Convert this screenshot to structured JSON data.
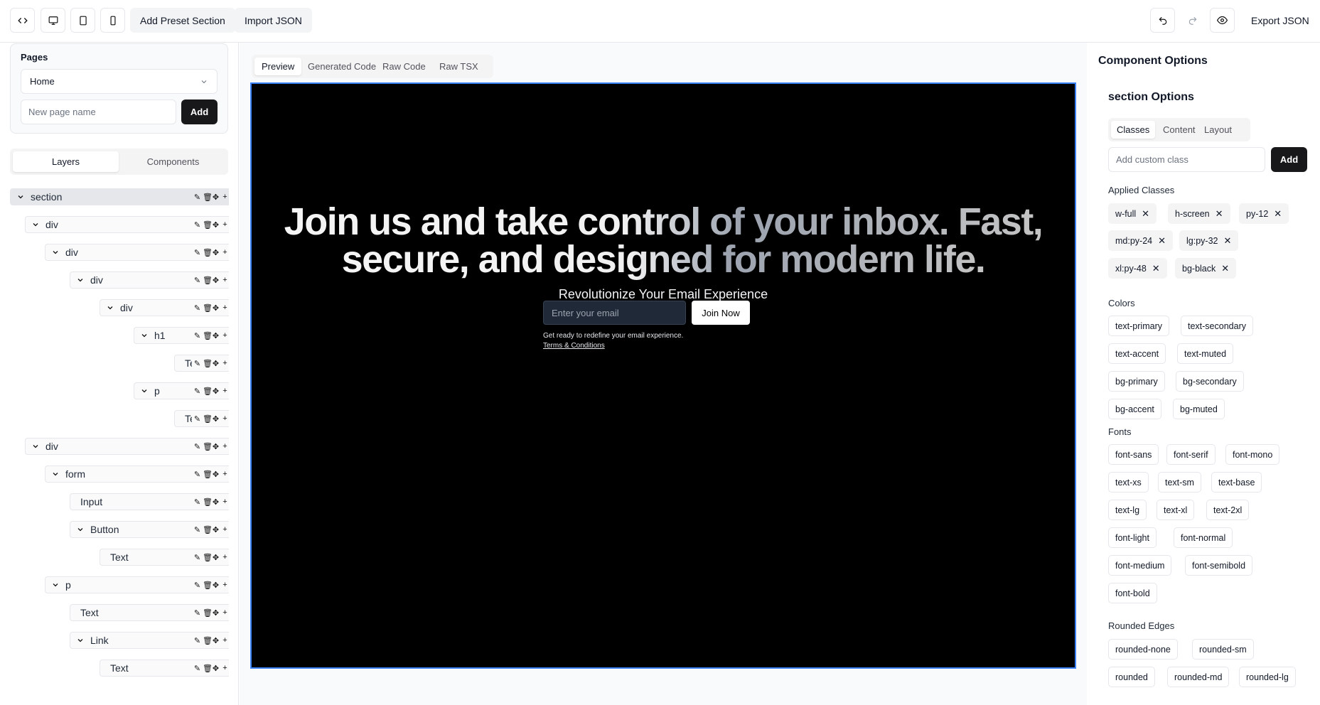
{
  "toolbar": {
    "code_icon": "code-icon",
    "desktop_icon": "monitor-icon",
    "tablet_icon": "tablet-icon",
    "mobile_icon": "smartphone-icon",
    "add_preset": "Add Preset Section",
    "import_json": "Import JSON",
    "undo_icon": "undo-icon",
    "redo_icon": "redo-icon",
    "preview_icon": "eye-icon",
    "export_json": "Export JSON"
  },
  "pages": {
    "title": "Pages",
    "selected": "Home",
    "new_page_placeholder": "New page name",
    "add_label": "Add"
  },
  "left_tabs": [
    "Layers",
    "Components"
  ],
  "layers": [
    {
      "label": "section",
      "indent": 0,
      "expanded": true,
      "selected": true
    },
    {
      "label": "div",
      "indent": 1,
      "expanded": true
    },
    {
      "label": "div",
      "indent": 2,
      "expanded": true
    },
    {
      "label": "div",
      "indent": 3,
      "expanded": true
    },
    {
      "label": "div",
      "indent": 4,
      "expanded": true
    },
    {
      "label": "h1",
      "indent": 5,
      "expanded": true
    },
    {
      "label": "Text",
      "indent": 6,
      "expanded": false
    },
    {
      "label": "p",
      "indent": 5,
      "expanded": true
    },
    {
      "label": "Text",
      "indent": 6,
      "expanded": false
    },
    {
      "label": "div",
      "indent": 1,
      "expanded": true
    },
    {
      "label": "form",
      "indent": 2,
      "expanded": true
    },
    {
      "label": "Input",
      "indent": 3,
      "expanded": false
    },
    {
      "label": "Button",
      "indent": 3,
      "expanded": true
    },
    {
      "label": "Text",
      "indent": 4,
      "expanded": false
    },
    {
      "label": "p",
      "indent": 2,
      "expanded": true
    },
    {
      "label": "Text",
      "indent": 3,
      "expanded": false
    },
    {
      "label": "Link",
      "indent": 3,
      "expanded": true
    },
    {
      "label": "Text",
      "indent": 4,
      "expanded": false
    }
  ],
  "canvas_tabs": [
    "Preview",
    "Generated Code",
    "Raw Code",
    "Raw TSX"
  ],
  "preview": {
    "headline_a": "Join us and take control of your inbox. Fast,",
    "headline_b": "secure, and designed for modern life.",
    "subheading": "Revolutionize Your Email Experience",
    "email_placeholder": "Enter your email",
    "join_label": "Join Now",
    "note": "Get ready to redefine your email experience.",
    "terms": "Terms & Conditions"
  },
  "options": {
    "title": "Component Options",
    "section_title": "section Options",
    "tabs": [
      "Classes",
      "Content",
      "Layout"
    ],
    "custom_class_placeholder": "Add custom class",
    "add_label": "Add",
    "applied_title": "Applied Classes",
    "applied": [
      "w-full",
      "h-screen",
      "py-12",
      "md:py-24",
      "lg:py-32",
      "xl:py-48",
      "bg-black"
    ],
    "colors_title": "Colors",
    "colors": [
      "text-primary",
      "text-secondary",
      "text-accent",
      "text-muted",
      "bg-primary",
      "bg-secondary",
      "bg-accent",
      "bg-muted"
    ],
    "fonts_title": "Fonts",
    "fonts": [
      "font-sans",
      "font-serif",
      "font-mono",
      "text-xs",
      "text-sm",
      "text-base",
      "text-lg",
      "text-xl",
      "text-2xl",
      "font-light",
      "font-normal",
      "font-medium",
      "font-semibold",
      "font-bold"
    ],
    "rounded_title": "Rounded Edges",
    "rounded": [
      "rounded-none",
      "rounded-sm",
      "rounded",
      "rounded-md",
      "rounded-lg"
    ]
  }
}
